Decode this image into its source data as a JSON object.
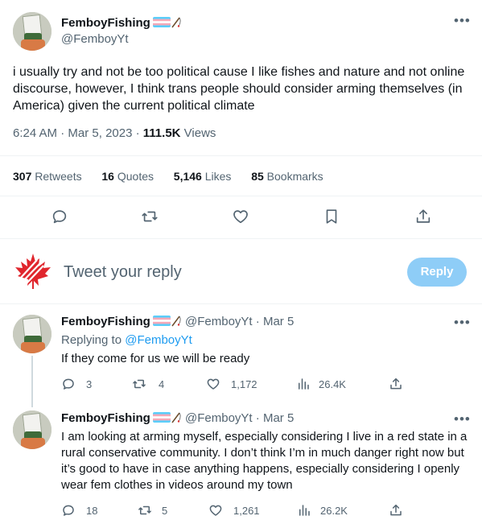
{
  "main_tweet": {
    "display_name": "FemboyFishing",
    "handle": "@FemboyYt",
    "text": "i usually try and not be too political cause I like fishes and nature and not online discourse, however, I think trans people should consider arming themselves (in America) given the current political climate",
    "time": "6:24 AM",
    "date": "Mar 5, 2023",
    "views_count": "111.5K",
    "views_label": "Views",
    "stats": {
      "retweets_count": "307",
      "retweets_label": "Retweets",
      "quotes_count": "16",
      "quotes_label": "Quotes",
      "likes_count": "5,146",
      "likes_label": "Likes",
      "bookmarks_count": "85",
      "bookmarks_label": "Bookmarks"
    }
  },
  "compose": {
    "placeholder": "Tweet your reply",
    "button_label": "Reply"
  },
  "replies": [
    {
      "display_name": "FemboyFishing",
      "handle": "@FemboyYt",
      "date": "Mar 5",
      "replying_to_label": "Replying to",
      "replying_to_handle": "@FemboyYt",
      "text": "If they come for us we will be ready",
      "replies": "3",
      "retweets": "4",
      "likes": "1,172",
      "views": "26.4K"
    },
    {
      "display_name": "FemboyFishing",
      "handle": "@FemboyYt",
      "date": "Mar 5",
      "text": "I am looking at arming myself, especially considering I live in a red state in a rural conservative community. I don’t think I’m in much danger right now but it’s good to have in case anything happens, especially considering I openly wear fem clothes in videos around my town",
      "replies": "18",
      "retweets": "5",
      "likes": "1,261",
      "views": "26.2K"
    }
  ],
  "colors": {
    "accent": "#1d9bf0",
    "reply_button_disabled": "#8ecdf7",
    "muted_text": "#536471",
    "divider": "#eff3f4",
    "maple_leaf": "#e0262d"
  },
  "icons": {
    "comment": "comment-icon",
    "retweet": "retweet-icon",
    "like": "heart-icon",
    "bookmark": "bookmark-icon",
    "share": "share-icon",
    "views": "views-icon",
    "more": "more-icon"
  }
}
